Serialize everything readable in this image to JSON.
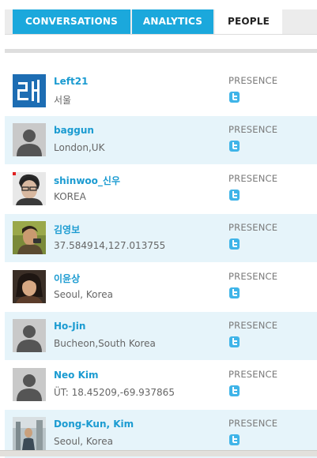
{
  "tabs": [
    {
      "label": "CONVERSATIONS",
      "active": false
    },
    {
      "label": "ANALYTICS",
      "active": false
    },
    {
      "label": "PEOPLE",
      "active": true
    }
  ],
  "people": [
    {
      "name": "Left21",
      "location": "서울",
      "presence": "PRESENCE",
      "avatar": "logo-avatar",
      "presence_icon": "twitter-icon"
    },
    {
      "name": "baggun",
      "location": "London,UK",
      "presence": "PRESENCE",
      "avatar": "default-avatar",
      "presence_icon": "twitter-icon"
    },
    {
      "name": "shinwoo_신우",
      "location": "KOREA",
      "presence": "PRESENCE",
      "avatar": "photo-avatar",
      "presence_icon": "twitter-icon"
    },
    {
      "name": "김영보",
      "location": "37.584914,127.013755",
      "presence": "PRESENCE",
      "avatar": "photo-avatar",
      "presence_icon": "twitter-icon"
    },
    {
      "name": "이윤상",
      "location": "Seoul, Korea",
      "presence": "PRESENCE",
      "avatar": "photo-avatar",
      "presence_icon": "twitter-icon"
    },
    {
      "name": "Ho-Jin",
      "location": "Bucheon,South Korea",
      "presence": "PRESENCE",
      "avatar": "default-avatar",
      "presence_icon": "twitter-icon"
    },
    {
      "name": "Neo Kim",
      "location": "ÜT: 18.45209,-69.937865",
      "presence": "PRESENCE",
      "avatar": "default-avatar",
      "presence_icon": "twitter-icon"
    },
    {
      "name": "Dong-Kun, Kim",
      "location": "Seoul, Korea",
      "presence": "PRESENCE",
      "avatar": "photo-avatar",
      "presence_icon": "twitter-icon"
    }
  ],
  "colors": {
    "tab_blue": "#1ba8dc",
    "name_blue": "#1b9bd1",
    "row_alt": "#e6f4fa",
    "twitter": "#3fb4e8"
  }
}
